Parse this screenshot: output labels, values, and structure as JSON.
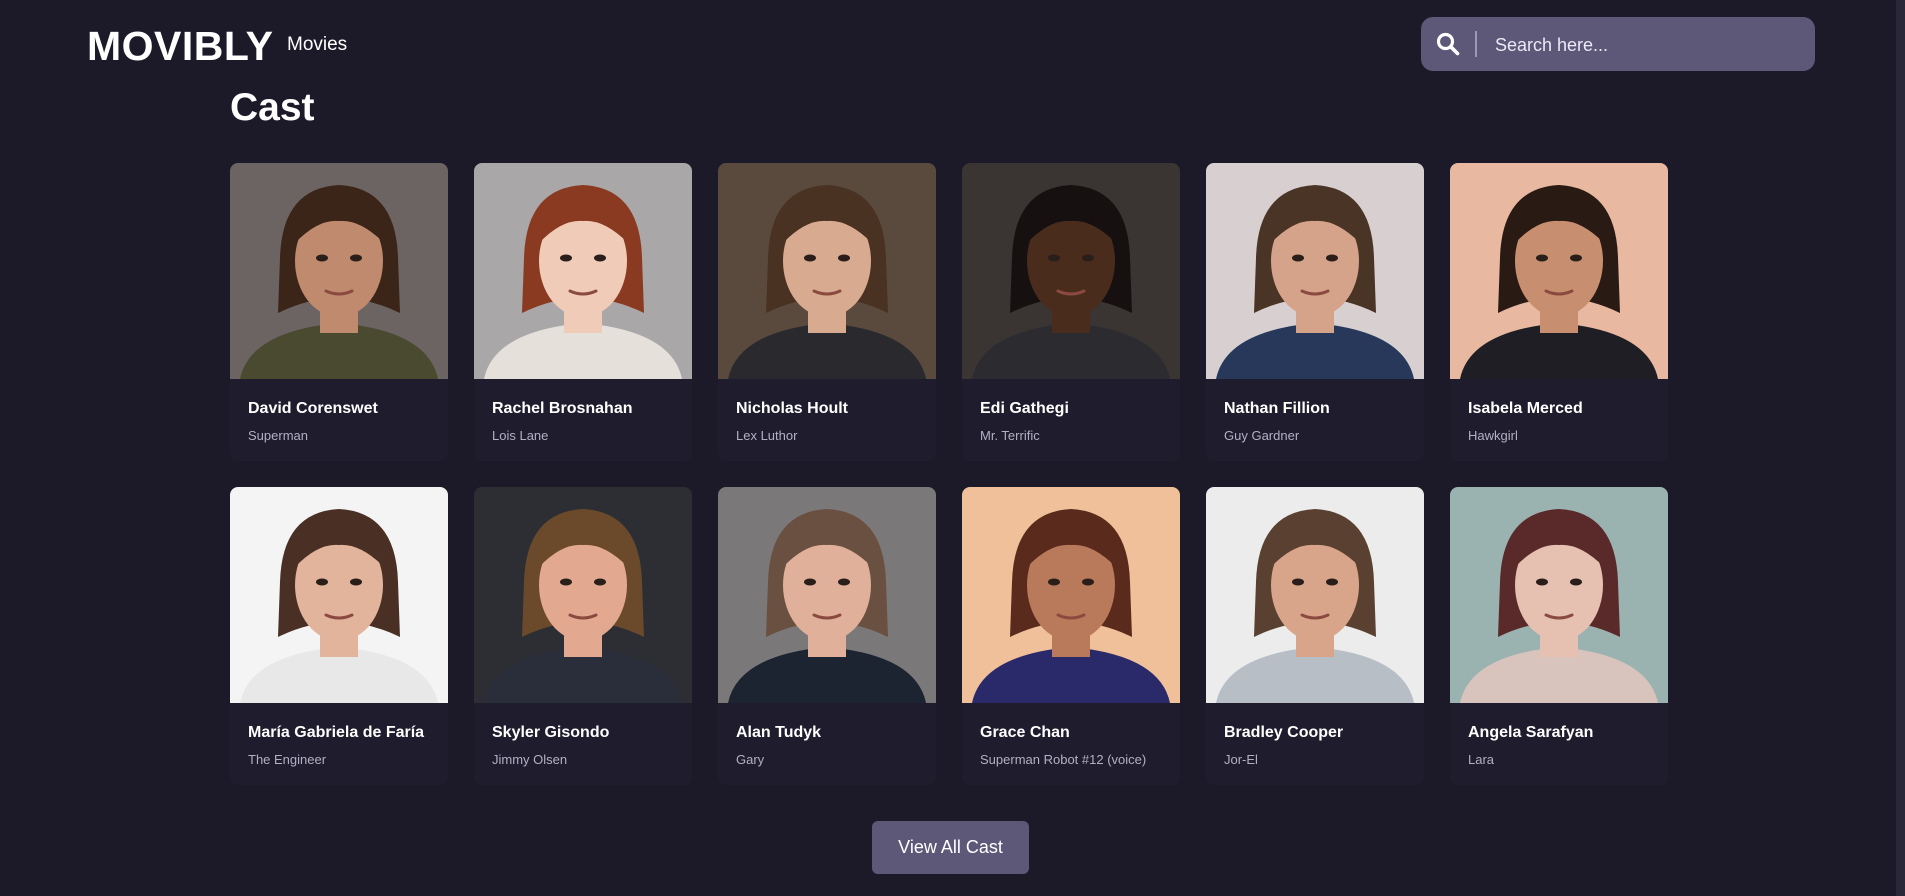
{
  "header": {
    "logo": "MOVIBLY",
    "nav": [
      "Movies"
    ],
    "search_placeholder": "Search here..."
  },
  "cast": {
    "title": "Cast",
    "members": [
      {
        "name": "David Corenswet",
        "role": "Superman",
        "bg": "#6b6462",
        "skin": "#c08a6e",
        "hair": "#3b2418",
        "shirt": "#4a4a30"
      },
      {
        "name": "Rachel Brosnahan",
        "role": "Lois Lane",
        "bg": "#a9a7a8",
        "skin": "#f0cbb8",
        "hair": "#8a3a20",
        "shirt": "#e5e1da"
      },
      {
        "name": "Nicholas Hoult",
        "role": "Lex Luthor",
        "bg": "#5a4a3e",
        "skin": "#d8aa90",
        "hair": "#4a3222",
        "shirt": "#2a2a2e"
      },
      {
        "name": "Edi Gathegi",
        "role": "Mr. Terrific",
        "bg": "#3a3432",
        "skin": "#4a2c1c",
        "hair": "#161010",
        "shirt": "#2c2c30"
      },
      {
        "name": "Nathan Fillion",
        "role": "Guy Gardner",
        "bg": "#d8d0d0",
        "skin": "#d5a28a",
        "hair": "#4a3426",
        "shirt": "#27385a"
      },
      {
        "name": "Isabela Merced",
        "role": "Hawkgirl",
        "bg": "#e8b8a0",
        "skin": "#c88e70",
        "hair": "#2a1a14",
        "shirt": "#1e1e24"
      },
      {
        "name": "María Gabriela de Faría",
        "role": "The Engineer",
        "bg": "#f4f4f4",
        "skin": "#e2b49c",
        "hair": "#4a3024",
        "shirt": "#e8e8e8"
      },
      {
        "name": "Skyler Gisondo",
        "role": "Jimmy Olsen",
        "bg": "#2c2e34",
        "skin": "#e2a890",
        "hair": "#6a4a2a",
        "shirt": "#2a2e3a"
      },
      {
        "name": "Alan Tudyk",
        "role": "Gary",
        "bg": "#7a7878",
        "skin": "#e0b09a",
        "hair": "#6a5040",
        "shirt": "#1c2432"
      },
      {
        "name": "Grace Chan",
        "role": "Superman Robot #12 (voice)",
        "bg": "#f0c09a",
        "skin": "#b87a5a",
        "hair": "#5a2a1c",
        "shirt": "#2a2a6a"
      },
      {
        "name": "Bradley Cooper",
        "role": "Jor-El",
        "bg": "#ececec",
        "skin": "#d8a58a",
        "hair": "#5a4030",
        "shirt": "#b8bec6"
      },
      {
        "name": "Angela Sarafyan",
        "role": "Lara",
        "bg": "#9ab2b0",
        "skin": "#e6c0b0",
        "hair": "#5a2a2a",
        "shirt": "#d8c4bc"
      }
    ]
  },
  "view_all_label": "View All Cast",
  "colors": {
    "background": "#1c1a29",
    "card": "#1f1d2d",
    "accent": "#5e5878",
    "muted_text": "#b3afc4"
  },
  "icons": {
    "search": "search-icon"
  }
}
